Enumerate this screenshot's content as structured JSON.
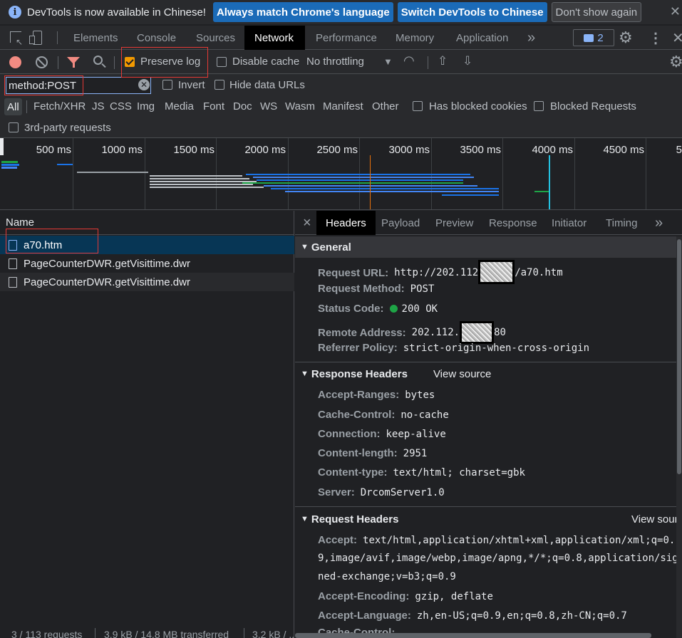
{
  "info_bar": {
    "message": "DevTools is now available in Chinese!",
    "match_button": "Always match Chrome's language",
    "switch_button": "Switch DevTools to Chinese",
    "dismiss_button": "Don't show again",
    "close_icon": "close-icon"
  },
  "tabs": {
    "items": [
      "Elements",
      "Console",
      "Sources",
      "Network",
      "Performance",
      "Memory",
      "Application"
    ],
    "active": "Network",
    "more": "»",
    "issues_count": "2"
  },
  "toolbar": {
    "preserve_log": "Preserve log",
    "disable_cache": "Disable cache",
    "throttling": "No throttling",
    "throttling_arrow": "▼"
  },
  "filter": {
    "value": "method:POST",
    "invert": "Invert",
    "hide_data_urls": "Hide data URLs"
  },
  "types": {
    "items": [
      "All",
      "Fetch/XHR",
      "JS",
      "CSS",
      "Img",
      "Media",
      "Font",
      "Doc",
      "WS",
      "Wasm",
      "Manifest",
      "Other"
    ],
    "has_blocked_cookies": "Has blocked cookies",
    "blocked_requests": "Blocked Requests",
    "third_party": "3rd-party requests"
  },
  "overview": {
    "ticks": [
      "500 ms",
      "1000 ms",
      "1500 ms",
      "2000 ms",
      "2500 ms",
      "3000 ms",
      "3500 ms",
      "4000 ms",
      "4500 ms",
      "5"
    ]
  },
  "requests": {
    "header": "Name",
    "items": [
      "a70.htm",
      "PageCounterDWR.getVisittime.dwr",
      "PageCounterDWR.getVisittime.dwr"
    ]
  },
  "status_bar": {
    "requests": "3 / 113 requests",
    "transferred": "3.9 kB / 14.8 MB transferred",
    "resources": "3.2 kB / ..."
  },
  "detail": {
    "close": "×",
    "tabs": [
      "Headers",
      "Payload",
      "Preview",
      "Response",
      "Initiator",
      "Timing"
    ],
    "more": "»",
    "general": {
      "title": "General",
      "request_url_key": "Request URL:",
      "request_url_prefix": "http://202.112",
      "request_url_suffix": "/a70.htm",
      "method_key": "Request Method:",
      "method": "POST",
      "status_key": "Status Code:",
      "status": "200 OK",
      "remote_key": "Remote Address:",
      "remote_prefix": "202.112.",
      "remote_suffix": "80",
      "referrer_key": "Referrer Policy:",
      "referrer": "strict-origin-when-cross-origin"
    },
    "response_headers": {
      "title": "Response Headers",
      "view_source": "View source",
      "items": [
        {
          "k": "Accept-Ranges:",
          "v": "bytes"
        },
        {
          "k": "Cache-Control:",
          "v": "no-cache"
        },
        {
          "k": "Connection:",
          "v": "keep-alive"
        },
        {
          "k": "Content-length:",
          "v": "2951"
        },
        {
          "k": "Content-type:",
          "v": "text/html; charset=gbk"
        },
        {
          "k": "Server:",
          "v": "DrcomServer1.0"
        }
      ]
    },
    "request_headers": {
      "title": "Request Headers",
      "view_source": "View sour",
      "accept_key": "Accept:",
      "accept_line1": "text/html,application/xhtml+xml,application/xml;q=0.",
      "accept_line2": "9,image/avif,image/webp,image/apng,*/*;q=0.8,application/sig",
      "accept_line3": "ned-exchange;v=b3;q=0.9",
      "encoding_key": "Accept-Encoding:",
      "encoding": "gzip, deflate",
      "language_key": "Accept-Language:",
      "language": "zh,en-US;q=0.9,en;q=0.8,zh-CN;q=0.7",
      "cache_key": "Cache-Control:"
    }
  },
  "colors": {
    "accent": "#8ab4f8",
    "selected_row": "#073655",
    "highlight_box": "#e53935",
    "checkbox_checked": "#f29900",
    "status_ok": "#1ea446"
  }
}
